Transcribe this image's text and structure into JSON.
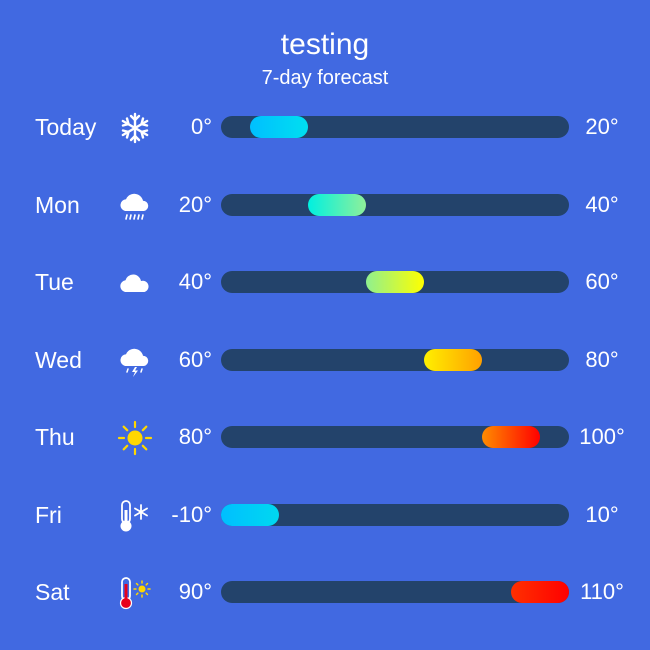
{
  "header": {
    "title": "testing",
    "subtitle": "7-day forecast"
  },
  "colors": {
    "background": "#4169E1",
    "track": "#23436B"
  },
  "scale": {
    "min": -10,
    "max": 110
  },
  "days": [
    {
      "day": "Today",
      "icon": "snowflake-icon",
      "low": 0,
      "high": 20,
      "low_label": "0°",
      "high_label": "20°",
      "grad": [
        "#00BFFF",
        "#00DFF0"
      ]
    },
    {
      "day": "Mon",
      "icon": "rain-cloud-icon",
      "low": 20,
      "high": 40,
      "low_label": "20°",
      "high_label": "40°",
      "grad": [
        "#00F0E0",
        "#8FF09A"
      ]
    },
    {
      "day": "Tue",
      "icon": "cloud-icon",
      "low": 40,
      "high": 60,
      "low_label": "40°",
      "high_label": "60°",
      "grad": [
        "#8FF08F",
        "#FFFF00"
      ]
    },
    {
      "day": "Wed",
      "icon": "thunderstorm-icon",
      "low": 60,
      "high": 80,
      "low_label": "60°",
      "high_label": "80°",
      "grad": [
        "#FFF000",
        "#FFA000"
      ]
    },
    {
      "day": "Thu",
      "icon": "sun-icon",
      "low": 80,
      "high": 100,
      "low_label": "80°",
      "high_label": "100°",
      "grad": [
        "#FF8C00",
        "#FF0000"
      ]
    },
    {
      "day": "Fri",
      "icon": "thermometer-cold-icon",
      "low": -10,
      "high": 10,
      "low_label": "-10°",
      "high_label": "10°",
      "grad": [
        "#00BFFF",
        "#00D8F0"
      ]
    },
    {
      "day": "Sat",
      "icon": "thermometer-hot-icon",
      "low": 90,
      "high": 110,
      "low_label": "90°",
      "high_label": "110°",
      "grad": [
        "#FF3000",
        "#FF0000"
      ]
    }
  ]
}
